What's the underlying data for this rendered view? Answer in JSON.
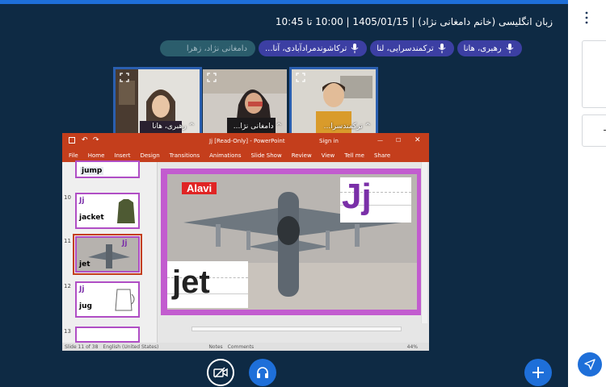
{
  "header": {
    "title": "زبان انگلیسی (خانم دامغانی نژاد) | 1405/01/15 | 10:00 تا 10:45"
  },
  "participants": [
    {
      "name": "دامغانی نژاد، زهرا",
      "muted": true
    },
    {
      "name": "ترکاشوندمرادآبادی، آنا...",
      "muted": false
    },
    {
      "name": "ترکمندسرایی، لنا",
      "muted": false
    },
    {
      "name": "رهبری، هانا",
      "muted": false
    }
  ],
  "videos": [
    {
      "label": "^ رهبری، هانا",
      "active": true
    },
    {
      "label": "^ دامغانی نژا...",
      "active": false
    },
    {
      "label": "^ ترکمندسرا...",
      "active": true
    }
  ],
  "ppt": {
    "file_title": "Jj [Read-Only] - PowerPoint",
    "sign_in": "Sign in",
    "tabs": [
      "File",
      "Home",
      "Insert",
      "Design",
      "Transitions",
      "Animations",
      "Slide Show",
      "Review",
      "View",
      "Tell me",
      "Share"
    ],
    "thumbs": [
      {
        "num": "",
        "word": "jump",
        "letter": ""
      },
      {
        "num": "10",
        "word": "jacket",
        "letter": "Jj"
      },
      {
        "num": "11",
        "word": "jet",
        "letter": "Jj"
      },
      {
        "num": "12",
        "word": "jug",
        "letter": "Jj"
      },
      {
        "num": "13",
        "word": "",
        "letter": ""
      }
    ],
    "slide": {
      "badge": "Alavi",
      "letter": "Jj",
      "word": "jet"
    },
    "status": {
      "slide_info": "Slide 11 of 38",
      "lang": "English (United States)",
      "notes": "Notes",
      "comments": "Comments",
      "zoom": "44%"
    }
  },
  "colors": {
    "background": "#0e2a44",
    "accent": "#1e6fd9",
    "chip": "#3c3fa3",
    "ppt_red": "#c43e1c",
    "slide_border": "#c25ccf"
  }
}
